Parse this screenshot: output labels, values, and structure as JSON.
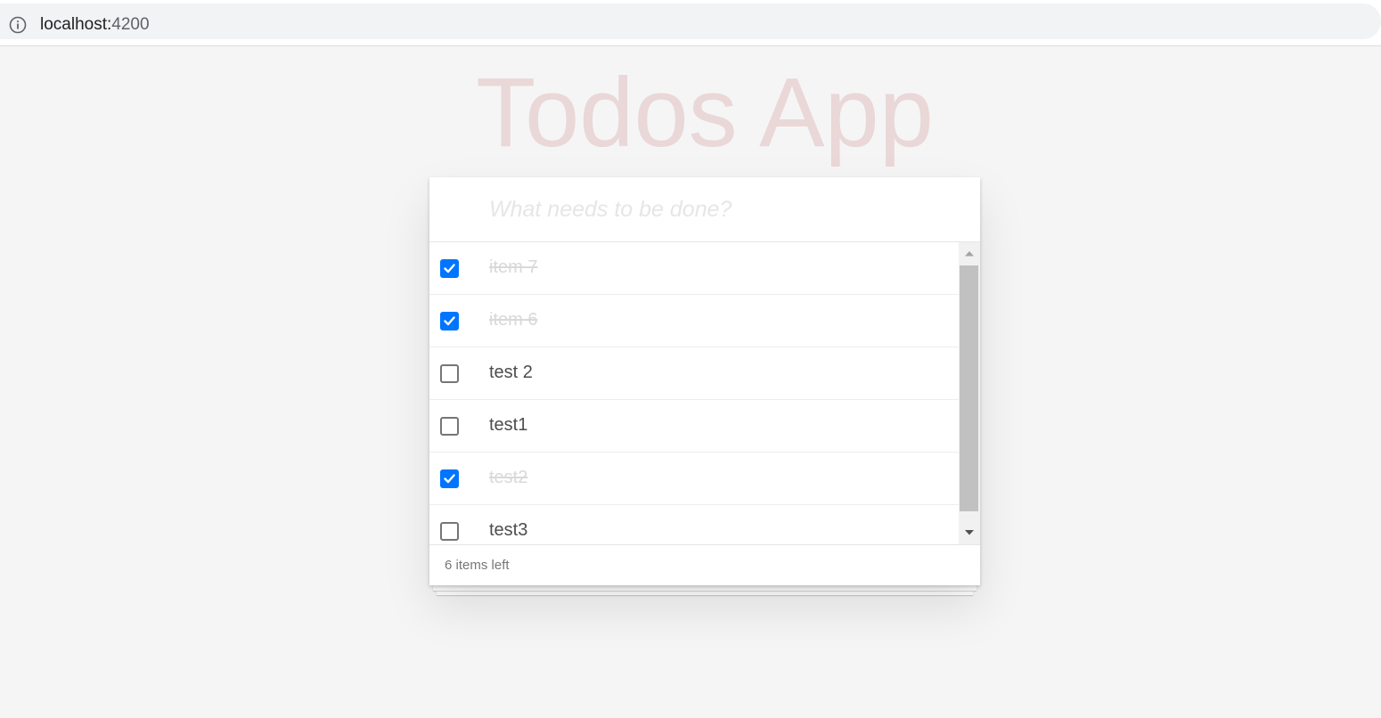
{
  "browser": {
    "url_host": "localhost:",
    "url_port": "4200"
  },
  "app": {
    "title": "Todos App"
  },
  "new_todo": {
    "placeholder": "What needs to be done?",
    "value": ""
  },
  "todos": [
    {
      "label": "item 7",
      "completed": true
    },
    {
      "label": "item 6",
      "completed": true
    },
    {
      "label": "test 2",
      "completed": false
    },
    {
      "label": "test1",
      "completed": false
    },
    {
      "label": "test2",
      "completed": true
    },
    {
      "label": "test3",
      "completed": false
    }
  ],
  "footer": {
    "count_text": "6 items left"
  },
  "colors": {
    "checkbox_checked": "#0075ff",
    "title_color": "rgba(175, 47, 47, 0.15)",
    "completed_text": "#d9d9d9",
    "active_text": "#4d4d4d"
  },
  "icons": {
    "address_bar": "info-icon",
    "checkbox_mark": "checkmark-icon",
    "scroll_up": "triangle-up-icon",
    "scroll_down": "triangle-down-icon"
  }
}
